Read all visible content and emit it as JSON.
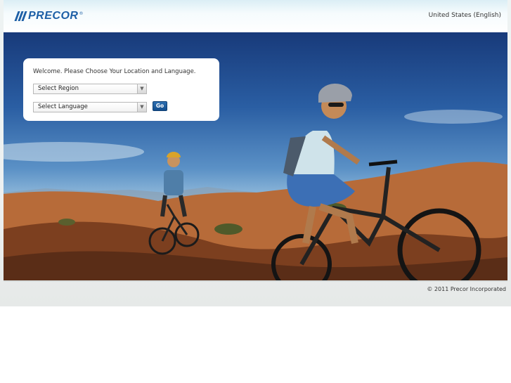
{
  "header": {
    "logo_text": "PRECOR",
    "logo_reg": "®",
    "locale_link": "United States (English)"
  },
  "welcome_panel": {
    "message": "Welcome. Please Choose Your Location and Language.",
    "region_select": {
      "selected": "Select Region"
    },
    "language_select": {
      "selected": "Select Language"
    },
    "go_label": "Go"
  },
  "footer": {
    "copyright": "© 2011 Precor Incorporated"
  },
  "colors": {
    "brand": "#1d5fa6",
    "go_button": "#1a5a99"
  }
}
